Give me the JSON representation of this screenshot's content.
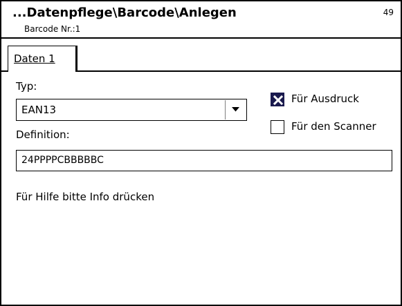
{
  "header": {
    "title": "...Datenpflege\\Barcode\\Anlegen",
    "subtitle": "Barcode Nr.:1",
    "counter": "49"
  },
  "tabs": [
    {
      "label": "Daten 1",
      "active": true
    }
  ],
  "form": {
    "typ_label": "Typ:",
    "typ_value": "EAN13",
    "definition_label": "Definition:",
    "definition_value": "24PPPPCBBBBBC",
    "fuer_ausdruck_label": "Für Ausdruck",
    "fuer_ausdruck_checked": true,
    "fuer_scanner_label": "Für den Scanner",
    "fuer_scanner_checked": false,
    "help_text": "Für Hilfe bitte Info drücken"
  },
  "icons": {
    "dropdown": "chevron-down-icon",
    "check": "x-check-icon"
  },
  "colors": {
    "checkbox_checked_bg": "#1a1a4e",
    "border": "#000000"
  }
}
